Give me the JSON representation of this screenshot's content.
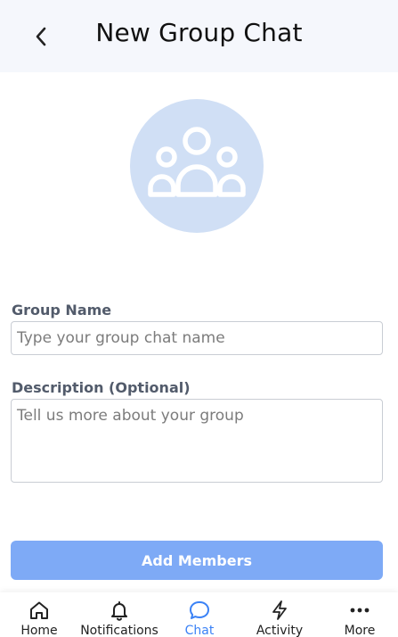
{
  "header": {
    "title": "New Group Chat",
    "back_icon": "chevron-left-icon"
  },
  "avatar": {
    "icon": "group-people-icon",
    "background": "#d0dff5"
  },
  "form": {
    "group_name_label": "Group Name",
    "group_name_value": "",
    "group_name_placeholder": "Type your group chat name",
    "description_label": "Description (Optional)",
    "description_value": "",
    "description_placeholder": "Tell us more about your group",
    "submit_label": "Add Members",
    "submit_color": "#7eaaf6"
  },
  "bottom_nav": {
    "active": "Chat",
    "active_color": "#3b82f6",
    "items": [
      {
        "label": "Home",
        "icon": "home-icon"
      },
      {
        "label": "Notifications",
        "icon": "bell-icon"
      },
      {
        "label": "Chat",
        "icon": "chat-bubble-icon"
      },
      {
        "label": "Activity",
        "icon": "lightning-icon"
      },
      {
        "label": "More",
        "icon": "more-dots-icon"
      }
    ]
  }
}
